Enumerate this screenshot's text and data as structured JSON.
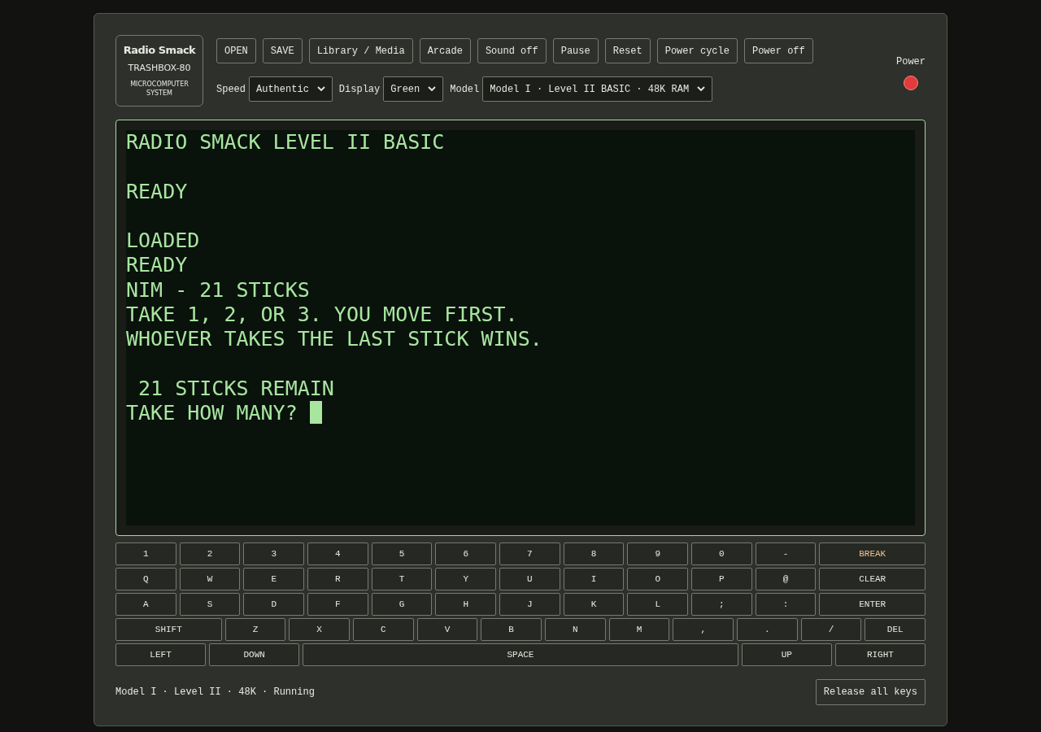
{
  "logo": {
    "brand": "Radio Smack",
    "model": "TRASHBOX-80",
    "subtitle": "MICROCOMPUTER SYSTEM"
  },
  "toolbar": [
    "OPEN",
    "SAVE",
    "Library / Media",
    "Arcade",
    "Sound off",
    "Pause",
    "Reset",
    "Power cycle",
    "Power off"
  ],
  "settings": [
    {
      "label": "Speed",
      "value": "Authentic"
    },
    {
      "label": "Display",
      "value": "Green"
    },
    {
      "label": "Model",
      "value": "Model I · Level II BASIC · 48K RAM"
    }
  ],
  "power": {
    "label": "Power",
    "on": true
  },
  "screen": {
    "blocks": [
      [
        "RADIO SMACK LEVEL II BASIC"
      ],
      [
        "READY"
      ],
      [
        "LOADED",
        "READY",
        "NIM - 21 STICKS",
        "TAKE 1, 2, OR 3. YOU MOVE FIRST.",
        "WHOEVER TAKES THE LAST STICK WINS."
      ],
      [
        " 21 STICKS REMAIN",
        "TAKE HOW MANY? "
      ]
    ],
    "cursor": true
  },
  "keyboard": [
    [
      {
        "label": "1",
        "kind": "normal"
      },
      {
        "label": "2",
        "kind": "normal"
      },
      {
        "label": "3",
        "kind": "normal"
      },
      {
        "label": "4",
        "kind": "normal"
      },
      {
        "label": "5",
        "kind": "normal"
      },
      {
        "label": "6",
        "kind": "normal"
      },
      {
        "label": "7",
        "kind": "normal"
      },
      {
        "label": "8",
        "kind": "normal"
      },
      {
        "label": "9",
        "kind": "normal"
      },
      {
        "label": "0",
        "kind": "normal"
      },
      {
        "label": "-",
        "kind": "normal"
      },
      {
        "label": "BREAK",
        "kind": "accent"
      }
    ],
    [
      {
        "label": "Q",
        "kind": "normal"
      },
      {
        "label": "W",
        "kind": "normal"
      },
      {
        "label": "E",
        "kind": "normal"
      },
      {
        "label": "R",
        "kind": "normal"
      },
      {
        "label": "T",
        "kind": "normal"
      },
      {
        "label": "Y",
        "kind": "normal"
      },
      {
        "label": "U",
        "kind": "normal"
      },
      {
        "label": "I",
        "kind": "normal"
      },
      {
        "label": "O",
        "kind": "normal"
      },
      {
        "label": "P",
        "kind": "normal"
      },
      {
        "label": "@",
        "kind": "normal"
      },
      {
        "label": "CLEAR",
        "kind": "wide"
      }
    ],
    [
      {
        "label": "A",
        "kind": "normal"
      },
      {
        "label": "S",
        "kind": "normal"
      },
      {
        "label": "D",
        "kind": "normal"
      },
      {
        "label": "F",
        "kind": "normal"
      },
      {
        "label": "G",
        "kind": "normal"
      },
      {
        "label": "H",
        "kind": "normal"
      },
      {
        "label": "J",
        "kind": "normal"
      },
      {
        "label": "K",
        "kind": "normal"
      },
      {
        "label": "L",
        "kind": "normal"
      },
      {
        "label": ";",
        "kind": "normal"
      },
      {
        "label": ":",
        "kind": "normal"
      },
      {
        "label": "ENTER",
        "kind": "wide"
      }
    ],
    [
      {
        "label": "SHIFT",
        "kind": "wide"
      },
      {
        "label": "Z",
        "kind": "normal"
      },
      {
        "label": "X",
        "kind": "normal"
      },
      {
        "label": "C",
        "kind": "normal"
      },
      {
        "label": "V",
        "kind": "normal"
      },
      {
        "label": "B",
        "kind": "normal"
      },
      {
        "label": "N",
        "kind": "normal"
      },
      {
        "label": "M",
        "kind": "normal"
      },
      {
        "label": ",",
        "kind": "normal"
      },
      {
        "label": ".",
        "kind": "normal"
      },
      {
        "label": "/",
        "kind": "normal"
      },
      {
        "label": "DEL",
        "kind": "normal"
      }
    ],
    [
      {
        "label": "LEFT",
        "kind": "arrow"
      },
      {
        "label": "DOWN",
        "kind": "arrow"
      },
      {
        "label": "SPACE",
        "kind": "space"
      },
      {
        "label": "UP",
        "kind": "arrow"
      },
      {
        "label": "RIGHT",
        "kind": "arrow"
      }
    ]
  ],
  "status_bar": {
    "text": "Model I · Level II · 48K · Running",
    "button": "Release all keys"
  }
}
